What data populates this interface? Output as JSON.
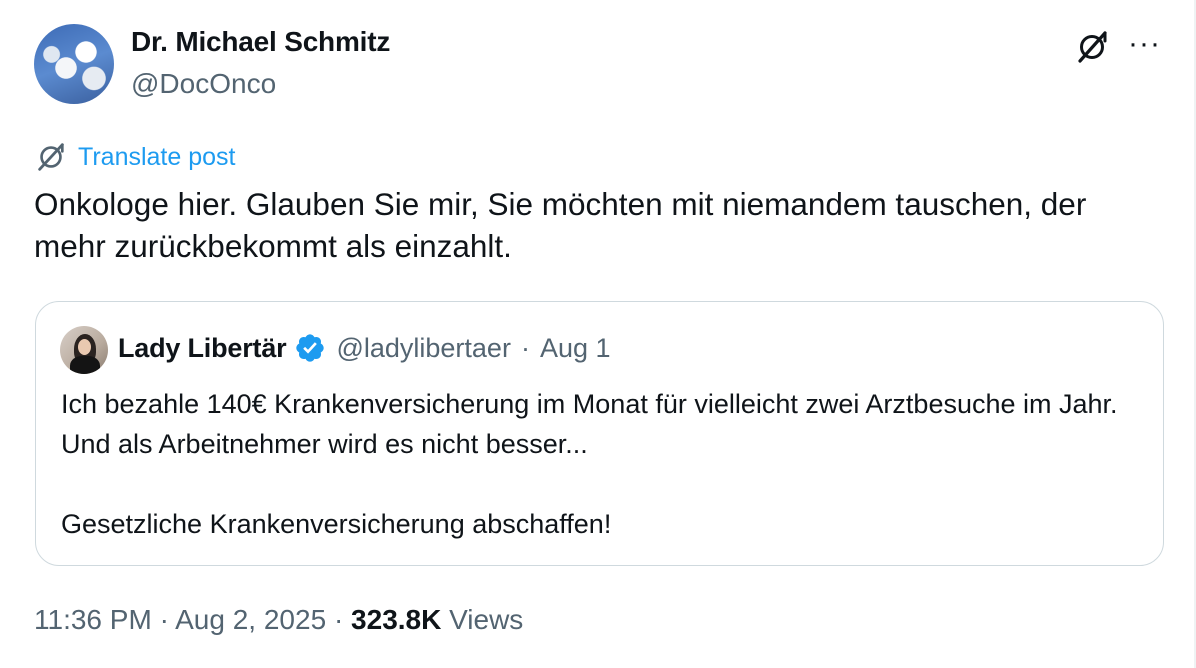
{
  "post": {
    "author_name": "Dr. Michael Schmitz",
    "author_handle": "@DocOnco",
    "translate_label": "Translate post",
    "text": "Onkologe hier. Glauben Sie mir, Sie möchten mit niemandem tauschen, der mehr zurückbekommt als einzahlt.",
    "more_label": "···",
    "time": "11:36 PM",
    "date": "Aug 2, 2025",
    "separator": "·",
    "views_count": "323.8K",
    "views_label": "Views"
  },
  "quote": {
    "author_name": "Lady Libertär",
    "author_handle": "@ladylibertaer",
    "separator": "·",
    "date": "Aug 1",
    "text": "Ich bezahle 140€ Krankenversicherung im Monat für vielleicht zwei Arztbesuche im Jahr. Und als Arbeitnehmer wird es nicht besser...\n\nGesetzliche Krankenversicherung abschaffen!",
    "verified": true
  },
  "colors": {
    "accent": "#1d9bf0",
    "secondary_text": "#536471",
    "primary_text": "#0f1419",
    "border": "#cfd9de"
  },
  "icons": {
    "grok": "grok-icon",
    "more": "more-icon",
    "translate": "translate-icon",
    "verified": "verified-badge-icon"
  }
}
